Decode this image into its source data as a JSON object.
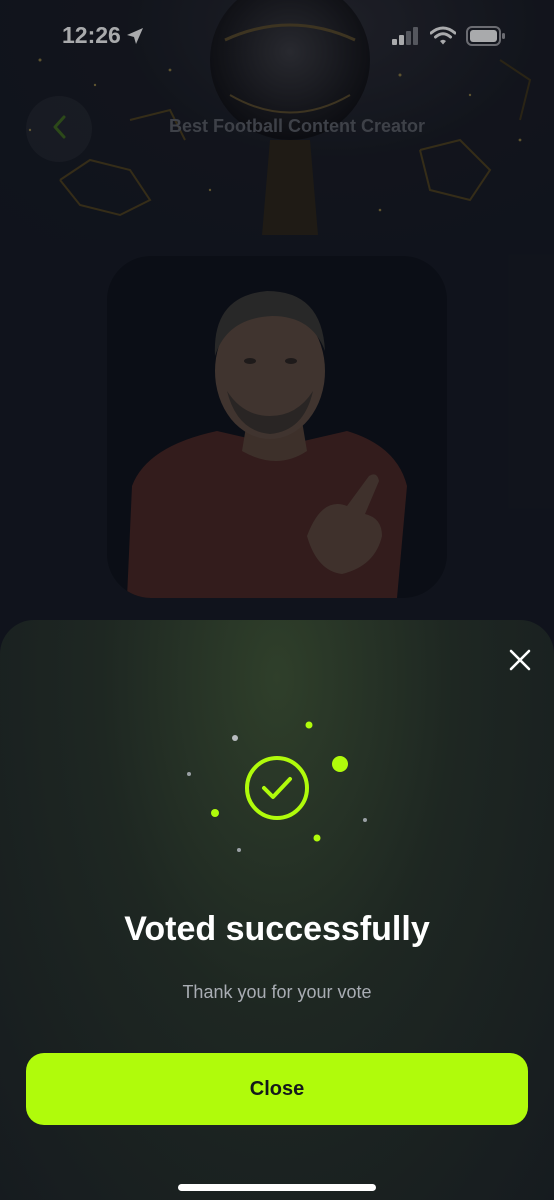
{
  "status_bar": {
    "time": "12:26"
  },
  "header": {
    "title": "Best Football Content Creator"
  },
  "modal": {
    "title": "Voted successfully",
    "subtitle": "Thank you for your vote",
    "close_label": "Close"
  },
  "colors": {
    "accent": "#b0fb0b",
    "background": "#141822",
    "sheet": "#1e2722",
    "title_muted": "#5b5e66"
  }
}
